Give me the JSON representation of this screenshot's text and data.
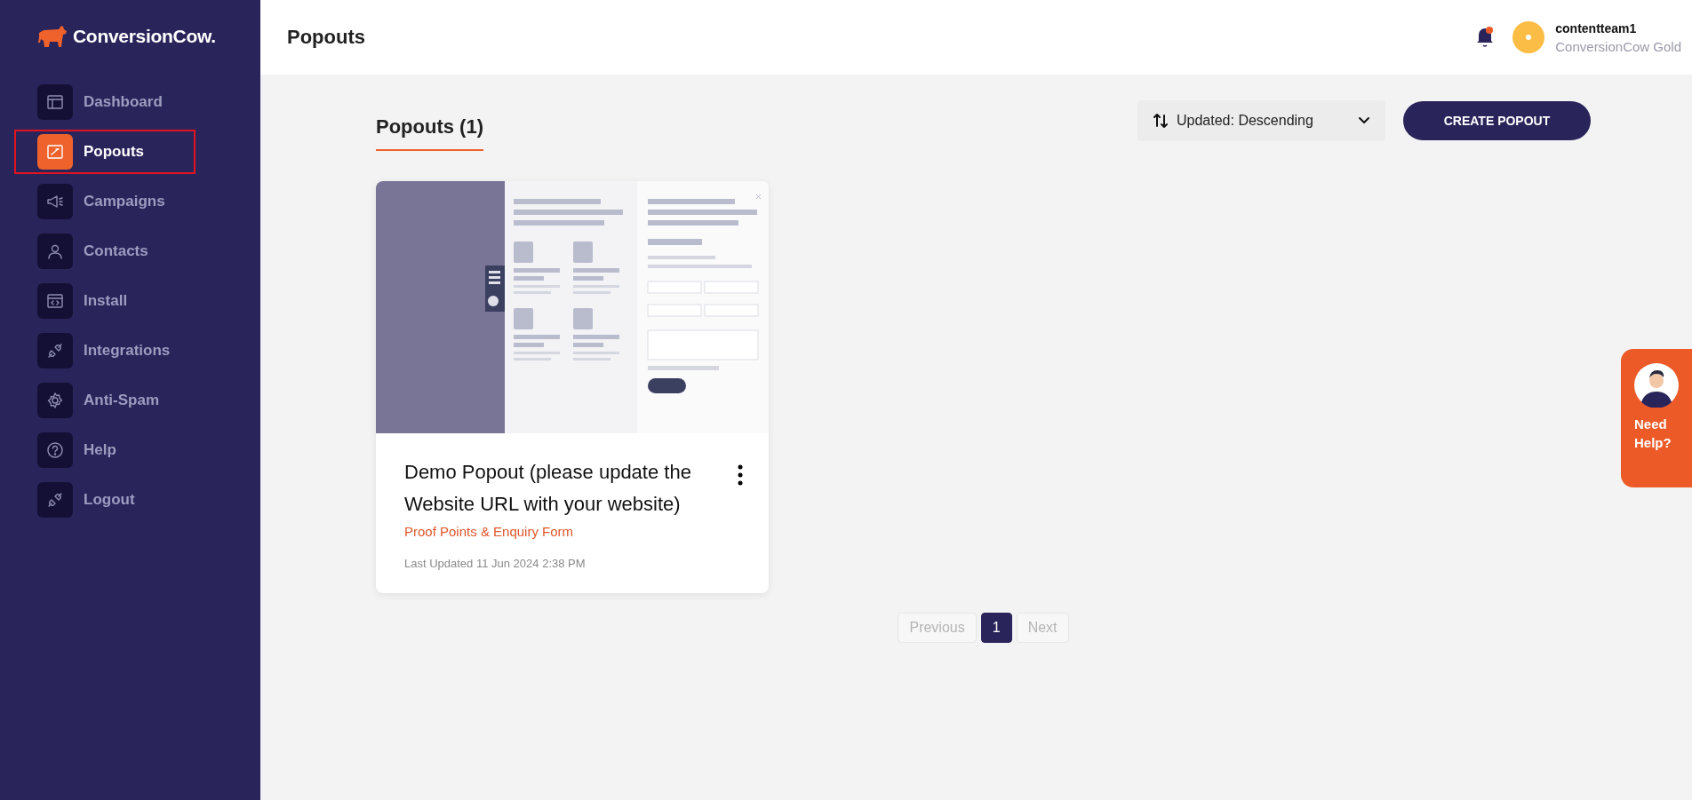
{
  "logo": {
    "text": "ConversionCow."
  },
  "sidebar": {
    "items": [
      {
        "label": "Dashboard",
        "selected": false
      },
      {
        "label": "Popouts",
        "selected": true
      },
      {
        "label": "Campaigns",
        "selected": false
      },
      {
        "label": "Contacts",
        "selected": false
      },
      {
        "label": "Install",
        "selected": false
      },
      {
        "label": "Integrations",
        "selected": false
      },
      {
        "label": "Anti-Spam",
        "selected": false
      },
      {
        "label": "Help",
        "selected": false
      },
      {
        "label": "Logout",
        "selected": false
      }
    ]
  },
  "header": {
    "title": "Popouts",
    "notification": {
      "unread": true
    },
    "user": {
      "name": "contentteam1",
      "plan": "ConversionCow Gold"
    }
  },
  "content": {
    "heading": "Popouts (1)",
    "sort": {
      "value": "Updated: Descending"
    },
    "create_button": "CREATE POPOUT",
    "cards": [
      {
        "title": "Demo Popout (please update the Website URL with your website)",
        "type": "Proof Points & Enquiry Form",
        "updated": "Last Updated 11 Jun 2024 2:38 PM"
      }
    ],
    "pagination": {
      "previous": "Previous",
      "next": "Next",
      "previous_disabled": true,
      "next_disabled": true,
      "pages": [
        {
          "label": "1",
          "selected": true
        }
      ]
    }
  },
  "help_widget": {
    "label": "Need Help?"
  }
}
